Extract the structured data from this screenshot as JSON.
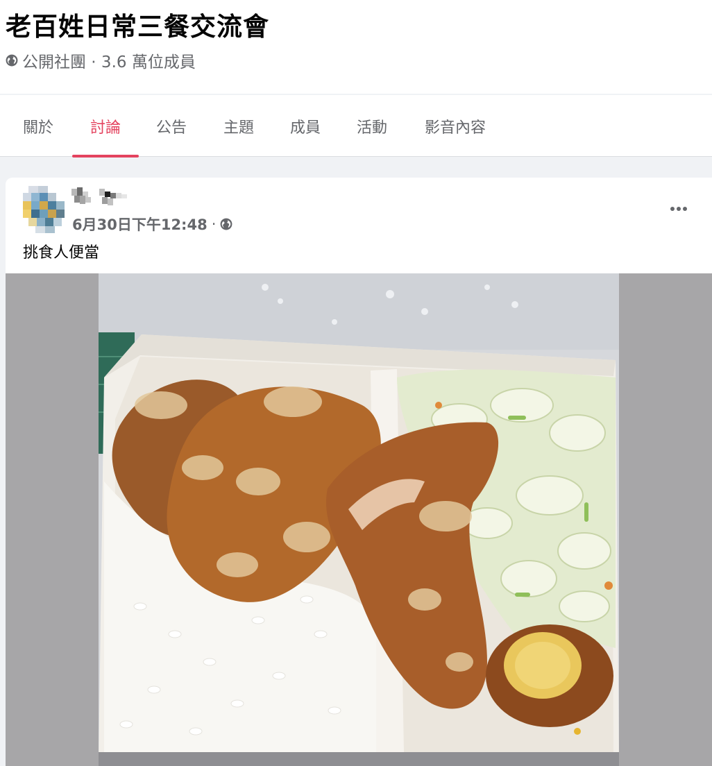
{
  "group": {
    "title": "老百姓日常三餐交流會",
    "privacy_icon": "globe-icon",
    "meta": "公開社團 · 3.6 萬位成員"
  },
  "tabs": [
    {
      "label": "關於",
      "active": false
    },
    {
      "label": "討論",
      "active": true
    },
    {
      "label": "公告",
      "active": false
    },
    {
      "label": "主題",
      "active": false
    },
    {
      "label": "成員",
      "active": false
    },
    {
      "label": "活動",
      "active": false
    },
    {
      "label": "影音內容",
      "active": false
    }
  ],
  "post": {
    "timestamp": "6月30日下午12:48",
    "separator": "·",
    "audience_icon": "globe-icon",
    "more_icon": "more-horizontal-icon",
    "text": "挑食人便當"
  },
  "colors": {
    "accent": "#e4435f",
    "secondary_text": "#65676b",
    "page_background": "#f0f2f5"
  }
}
